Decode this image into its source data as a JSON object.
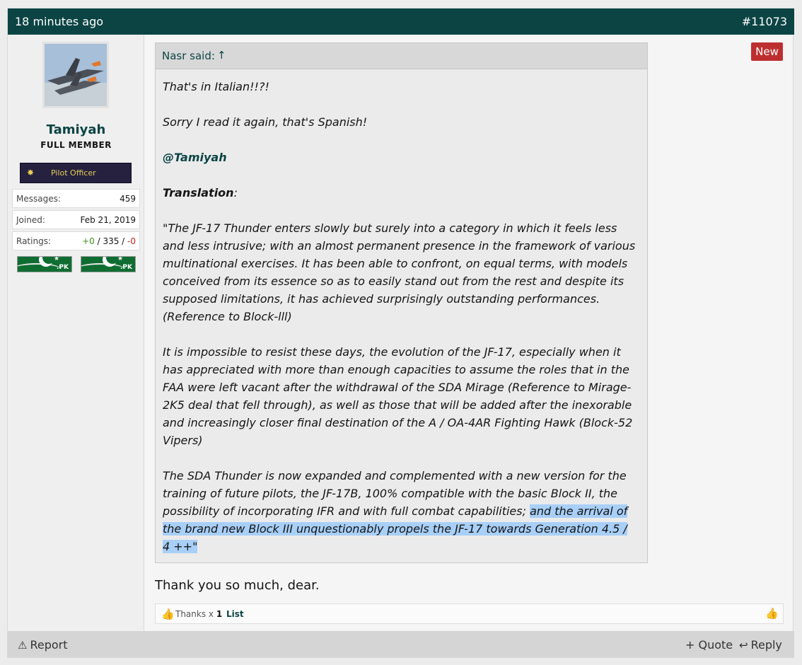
{
  "post": {
    "time": "18 minutes ago",
    "number": "#11073",
    "new_badge": "New"
  },
  "user": {
    "name": "Tamiyah",
    "title": "FULL MEMBER",
    "rank": "Pilot Officer",
    "stats": [
      {
        "key": "Messages:",
        "value": "459"
      },
      {
        "key": "Joined:",
        "value": "Feb 21, 2019"
      }
    ],
    "ratings": {
      "key": "Ratings:",
      "positive": "+0",
      "sep1": " / ",
      "neutral": "335",
      "sep2": " / ",
      "negative": "-0"
    },
    "flags": [
      ".PK",
      ".PK"
    ]
  },
  "quote": {
    "author_said": "Nasr said:",
    "arrow": "↑",
    "lines": {
      "l1": "That's in Italian!!?!",
      "l2": "Sorry I read it again, that's Spanish!",
      "mention": "@Tamiyah",
      "translation": "Translation",
      "colon": ":",
      "p1": [
        "\"The JF-17 Thunder enters slowly but surely into a category in which it feels less",
        "and less intrusive; with an almost permanent presence in the framework of various",
        "multinational exercises. It has been able to confront, on equal terms, with models",
        "conceived from its essence so as to easily stand out from the rest and despite its",
        "supposed limitations, it has achieved surprisingly outstanding performances.",
        "(Reference to Block-lll)"
      ],
      "p2": [
        "It is impossible to resist these days, the evolution of the JF-17, especially when it",
        "has appreciated with more than enough capacities to assume the roles that in the",
        "FAA were left vacant after the withdrawal of the SDA Mirage (Reference to Mirage-",
        "2K5 deal that fell through), as well as those that will be added after the inexorable",
        "and increasingly closer final destination of the A / OA-4AR Fighting Hawk (Block-52",
        "Vipers)"
      ],
      "p3a": "The SDA Thunder is now expanded and complemented with a new version for the",
      "p3b": "training of future pilots, the JF-17B, 100% compatible with the basic Block II, the",
      "p3c_plain": "possibility of incorporating IFR and with full combat capabilities; ",
      "p3c_hl": "and the arrival of",
      "p3d_hl": "the brand new Block III unquestionably propels the JF-17 towards Generation 4.5 /",
      "p3e_hl": "4 ++\""
    }
  },
  "reply": "Thank you so much, dear.",
  "likes": {
    "thanks": "Thanks x ",
    "count": "1",
    "list": "List"
  },
  "actions": {
    "report": "Report",
    "quote": "+ Quote",
    "reply": "Reply"
  },
  "icons": {
    "report": "warning-icon",
    "reply": "reply-icon",
    "like": "thumbs-up-icon"
  }
}
